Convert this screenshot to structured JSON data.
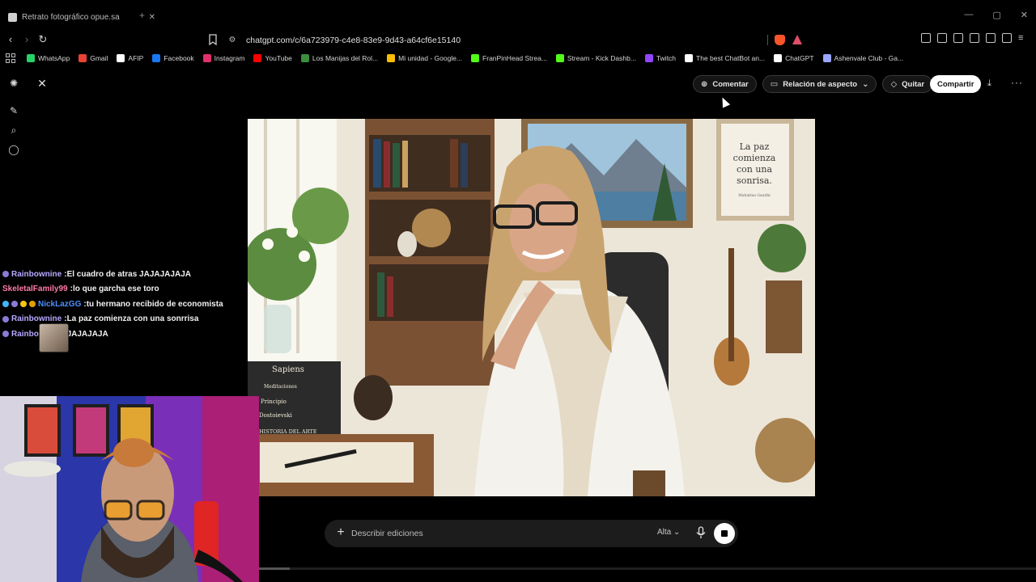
{
  "browser": {
    "tab_title": "Retrato fotográfico opue.sa",
    "url": "chatgpt.com/c/6a723979-c4e8-83e9-9d43-a64cf6e15140",
    "bookmarks": [
      {
        "label": "WhatsApp",
        "color": "#25d366"
      },
      {
        "label": "Gmail",
        "color": "#ea4335"
      },
      {
        "label": "AFIP",
        "color": "#ffffff"
      },
      {
        "label": "Facebook",
        "color": "#1877f2"
      },
      {
        "label": "Instagram",
        "color": "#e1306c"
      },
      {
        "label": "YouTube",
        "color": "#ff0000"
      },
      {
        "label": "Los Manijas del Rol...",
        "color": "#3c8f3c"
      },
      {
        "label": "Mi unidad - Google...",
        "color": "#fbbc04"
      },
      {
        "label": "FranPinHead Strea...",
        "color": "#53fc18"
      },
      {
        "label": "Stream - Kick Dashb...",
        "color": "#53fc18"
      },
      {
        "label": "Twitch",
        "color": "#9146ff"
      },
      {
        "label": "The best ChatBot an...",
        "color": "#ffffff"
      },
      {
        "label": "ChatGPT",
        "color": "#ffffff"
      },
      {
        "label": "Ashenvale Club - Ga...",
        "color": "#9aa7ff"
      }
    ]
  },
  "app": {
    "actions": {
      "comment": "Comentar",
      "aspect_ratio": "Relación de aspecto",
      "remove": "Quitar",
      "share": "Compartir"
    },
    "image": {
      "quote": "La paz comienza con una sonrisa.",
      "quote_author": "Mahatma Gandhi",
      "book_spines": [
        "Sapiens",
        "Meditaciones",
        "Principio",
        "Dostoievski",
        "HISTORIA DEL ARTE"
      ]
    },
    "composer": {
      "placeholder": "Describir ediciones",
      "quality": "Alta",
      "progress": 0.04
    }
  },
  "chat": {
    "messages": [
      {
        "user": "Rainbownine",
        "user_color": "#b8a8ff",
        "text": "El cuadro de atras JAJAJAJAJA",
        "badges": [
          "#8a7bd8"
        ]
      },
      {
        "user": "SkeletalFamily99",
        "user_color": "#ff7aa8",
        "text": "lo que garcha ese toro",
        "badges": []
      },
      {
        "user": "NickLazGG",
        "user_color": "#4a90ff",
        "text": "tu hermano recibido de economista",
        "badges": [
          "#3fb6ff",
          "#8a7bd8",
          "#f5c518",
          "#e0a000"
        ]
      },
      {
        "user": "Rainbownine",
        "user_color": "#b8a8ff",
        "text": "La paz comienza con una sonrrisa",
        "badges": [
          "#8a7bd8"
        ]
      },
      {
        "user": "Rainbownine",
        "user_color": "#b8a8ff",
        "text": "JAJAJAJA",
        "badges": [
          "#8a7bd8"
        ]
      }
    ]
  }
}
